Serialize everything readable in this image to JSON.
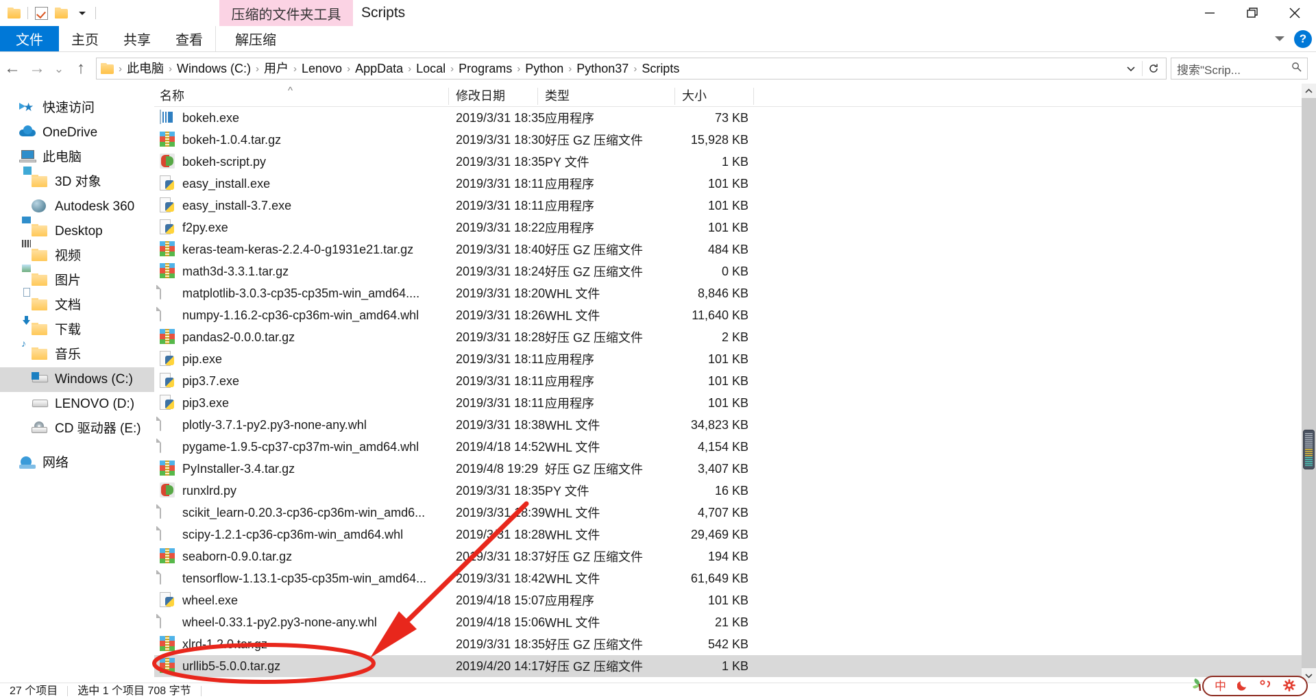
{
  "window": {
    "contextual_tab": "压缩的文件夹工具",
    "title": "Scripts",
    "minimize": "minimize-button",
    "maximize": "maximize-button",
    "close": "close-button",
    "help": "?"
  },
  "quick_access_toolbar": {
    "items": [
      "folder-icon",
      "properties-checkbox-icon",
      "new-folder-icon",
      "customize-dropdown-icon"
    ]
  },
  "ribbon": {
    "tabs": [
      {
        "label": "文件",
        "active": true
      },
      {
        "label": "主页",
        "active": false
      },
      {
        "label": "共享",
        "active": false
      },
      {
        "label": "查看",
        "active": false
      }
    ],
    "contextual_tabs": [
      {
        "label": "解压缩"
      }
    ]
  },
  "navigation": {
    "back": "←",
    "forward": "→",
    "recent": "⌄",
    "up": "↑",
    "dropdown": "⌄",
    "refresh": "↻"
  },
  "address": {
    "crumbs": [
      "此电脑",
      "Windows (C:)",
      "用户",
      "Lenovo",
      "AppData",
      "Local",
      "Programs",
      "Python",
      "Python37",
      "Scripts"
    ],
    "separator": "›"
  },
  "search": {
    "placeholder": "搜索\"Scrip...",
    "value": "搜索\"Scrip...",
    "icon": "search-icon"
  },
  "sidebar": {
    "items": [
      {
        "label": "快速访问",
        "icon": "quick-access-star-icon",
        "indent": false,
        "selected": false
      },
      {
        "label": "OneDrive",
        "icon": "onedrive-cloud-icon",
        "indent": false,
        "selected": false
      },
      {
        "label": "此电脑",
        "icon": "this-pc-icon",
        "indent": false,
        "selected": false
      },
      {
        "label": "3D 对象",
        "icon": "folder-3d-objects-icon",
        "indent": true,
        "selected": false
      },
      {
        "label": "Autodesk 360",
        "icon": "autodesk-360-icon",
        "indent": true,
        "selected": false
      },
      {
        "label": "Desktop",
        "icon": "folder-desktop-icon",
        "indent": true,
        "selected": false
      },
      {
        "label": "视频",
        "icon": "folder-videos-icon",
        "indent": true,
        "selected": false
      },
      {
        "label": "图片",
        "icon": "folder-pictures-icon",
        "indent": true,
        "selected": false
      },
      {
        "label": "文档",
        "icon": "folder-documents-icon",
        "indent": true,
        "selected": false
      },
      {
        "label": "下载",
        "icon": "folder-downloads-icon",
        "indent": true,
        "selected": false
      },
      {
        "label": "音乐",
        "icon": "folder-music-icon",
        "indent": true,
        "selected": false
      },
      {
        "label": "Windows (C:)",
        "icon": "drive-windows-icon",
        "indent": true,
        "selected": true
      },
      {
        "label": "LENOVO (D:)",
        "icon": "drive-icon",
        "indent": true,
        "selected": false
      },
      {
        "label": "CD 驱动器 (E:)",
        "icon": "cd-drive-icon",
        "indent": true,
        "selected": false
      },
      {
        "label": "网络",
        "icon": "network-icon",
        "indent": false,
        "selected": false
      }
    ]
  },
  "file_list": {
    "columns": {
      "name": "名称",
      "date_modified": "修改日期",
      "type": "类型",
      "size": "大小"
    },
    "sort_indicator": "^",
    "rows": [
      {
        "name": "bokeh.exe",
        "date": "2019/3/31 18:35",
        "type": "应用程序",
        "size": "73 KB",
        "icon": "exe-icon",
        "selected": false
      },
      {
        "name": "bokeh-1.0.4.tar.gz",
        "date": "2019/3/31 18:30",
        "type": "好压 GZ 压缩文件",
        "size": "15,928 KB",
        "icon": "gz-icon",
        "selected": false
      },
      {
        "name": "bokeh-script.py",
        "date": "2019/3/31 18:35",
        "type": "PY 文件",
        "size": "1 KB",
        "icon": "py-icon",
        "selected": false
      },
      {
        "name": "easy_install.exe",
        "date": "2019/3/31 18:11",
        "type": "应用程序",
        "size": "101 KB",
        "icon": "pyapp-icon",
        "selected": false
      },
      {
        "name": "easy_install-3.7.exe",
        "date": "2019/3/31 18:11",
        "type": "应用程序",
        "size": "101 KB",
        "icon": "pyapp-icon",
        "selected": false
      },
      {
        "name": "f2py.exe",
        "date": "2019/3/31 18:22",
        "type": "应用程序",
        "size": "101 KB",
        "icon": "pyapp-icon",
        "selected": false
      },
      {
        "name": "keras-team-keras-2.2.4-0-g1931e21.tar.gz",
        "date": "2019/3/31 18:40",
        "type": "好压 GZ 压缩文件",
        "size": "484 KB",
        "icon": "gz-icon",
        "selected": false
      },
      {
        "name": "math3d-3.3.1.tar.gz",
        "date": "2019/3/31 18:24",
        "type": "好压 GZ 压缩文件",
        "size": "0 KB",
        "icon": "gz-icon",
        "selected": false
      },
      {
        "name": "matplotlib-3.0.3-cp35-cp35m-win_amd64....",
        "date": "2019/3/31 18:20",
        "type": "WHL 文件",
        "size": "8,846 KB",
        "icon": "whl-icon",
        "selected": false
      },
      {
        "name": "numpy-1.16.2-cp36-cp36m-win_amd64.whl",
        "date": "2019/3/31 18:26",
        "type": "WHL 文件",
        "size": "11,640 KB",
        "icon": "whl-icon",
        "selected": false
      },
      {
        "name": "pandas2-0.0.0.tar.gz",
        "date": "2019/3/31 18:28",
        "type": "好压 GZ 压缩文件",
        "size": "2 KB",
        "icon": "gz-icon",
        "selected": false
      },
      {
        "name": "pip.exe",
        "date": "2019/3/31 18:11",
        "type": "应用程序",
        "size": "101 KB",
        "icon": "pyapp-icon",
        "selected": false
      },
      {
        "name": "pip3.7.exe",
        "date": "2019/3/31 18:11",
        "type": "应用程序",
        "size": "101 KB",
        "icon": "pyapp-icon",
        "selected": false
      },
      {
        "name": "pip3.exe",
        "date": "2019/3/31 18:11",
        "type": "应用程序",
        "size": "101 KB",
        "icon": "pyapp-icon",
        "selected": false
      },
      {
        "name": "plotly-3.7.1-py2.py3-none-any.whl",
        "date": "2019/3/31 18:38",
        "type": "WHL 文件",
        "size": "34,823 KB",
        "icon": "whl-icon",
        "selected": false
      },
      {
        "name": "pygame-1.9.5-cp37-cp37m-win_amd64.whl",
        "date": "2019/4/18 14:52",
        "type": "WHL 文件",
        "size": "4,154 KB",
        "icon": "whl-icon",
        "selected": false
      },
      {
        "name": "PyInstaller-3.4.tar.gz",
        "date": "2019/4/8 19:29",
        "type": "好压 GZ 压缩文件",
        "size": "3,407 KB",
        "icon": "gz-icon",
        "selected": false
      },
      {
        "name": "runxlrd.py",
        "date": "2019/3/31 18:35",
        "type": "PY 文件",
        "size": "16 KB",
        "icon": "py-icon",
        "selected": false
      },
      {
        "name": "scikit_learn-0.20.3-cp36-cp36m-win_amd6...",
        "date": "2019/3/31 18:39",
        "type": "WHL 文件",
        "size": "4,707 KB",
        "icon": "whl-icon",
        "selected": false
      },
      {
        "name": "scipy-1.2.1-cp36-cp36m-win_amd64.whl",
        "date": "2019/3/31 18:28",
        "type": "WHL 文件",
        "size": "29,469 KB",
        "icon": "whl-icon",
        "selected": false
      },
      {
        "name": "seaborn-0.9.0.tar.gz",
        "date": "2019/3/31 18:37",
        "type": "好压 GZ 压缩文件",
        "size": "194 KB",
        "icon": "gz-icon",
        "selected": false
      },
      {
        "name": "tensorflow-1.13.1-cp35-cp35m-win_amd64...",
        "date": "2019/3/31 18:42",
        "type": "WHL 文件",
        "size": "61,649 KB",
        "icon": "whl-icon",
        "selected": false
      },
      {
        "name": "wheel.exe",
        "date": "2019/4/18 15:07",
        "type": "应用程序",
        "size": "101 KB",
        "icon": "pyapp-icon",
        "selected": false
      },
      {
        "name": "wheel-0.33.1-py2.py3-none-any.whl",
        "date": "2019/4/18 15:06",
        "type": "WHL 文件",
        "size": "21 KB",
        "icon": "whl-icon",
        "selected": false
      },
      {
        "name": "xlrd-1.2.0.tar.gz",
        "date": "2019/3/31 18:35",
        "type": "好压 GZ 压缩文件",
        "size": "542 KB",
        "icon": "gz-icon",
        "selected": false
      },
      {
        "name": "urllib5-5.0.0.tar.gz",
        "date": "2019/4/20 14:17",
        "type": "好压 GZ 压缩文件",
        "size": "1 KB",
        "icon": "gz-icon",
        "selected": true
      }
    ]
  },
  "status_bar": {
    "item_count": "27 个项目",
    "selection": "选中 1 个项目  708 字节"
  },
  "ime_toolbar": {
    "items": [
      "中",
      "moon-icon",
      "punctuation-icon",
      "settings-gear-icon"
    ],
    "accent": "#e23b2e"
  },
  "annotations": {
    "highlight_color": "#e8271c",
    "ellipse_target": "urllib5-5.0.0.tar.gz",
    "arrow": "red-arrow-pointing-to-urllib5"
  }
}
